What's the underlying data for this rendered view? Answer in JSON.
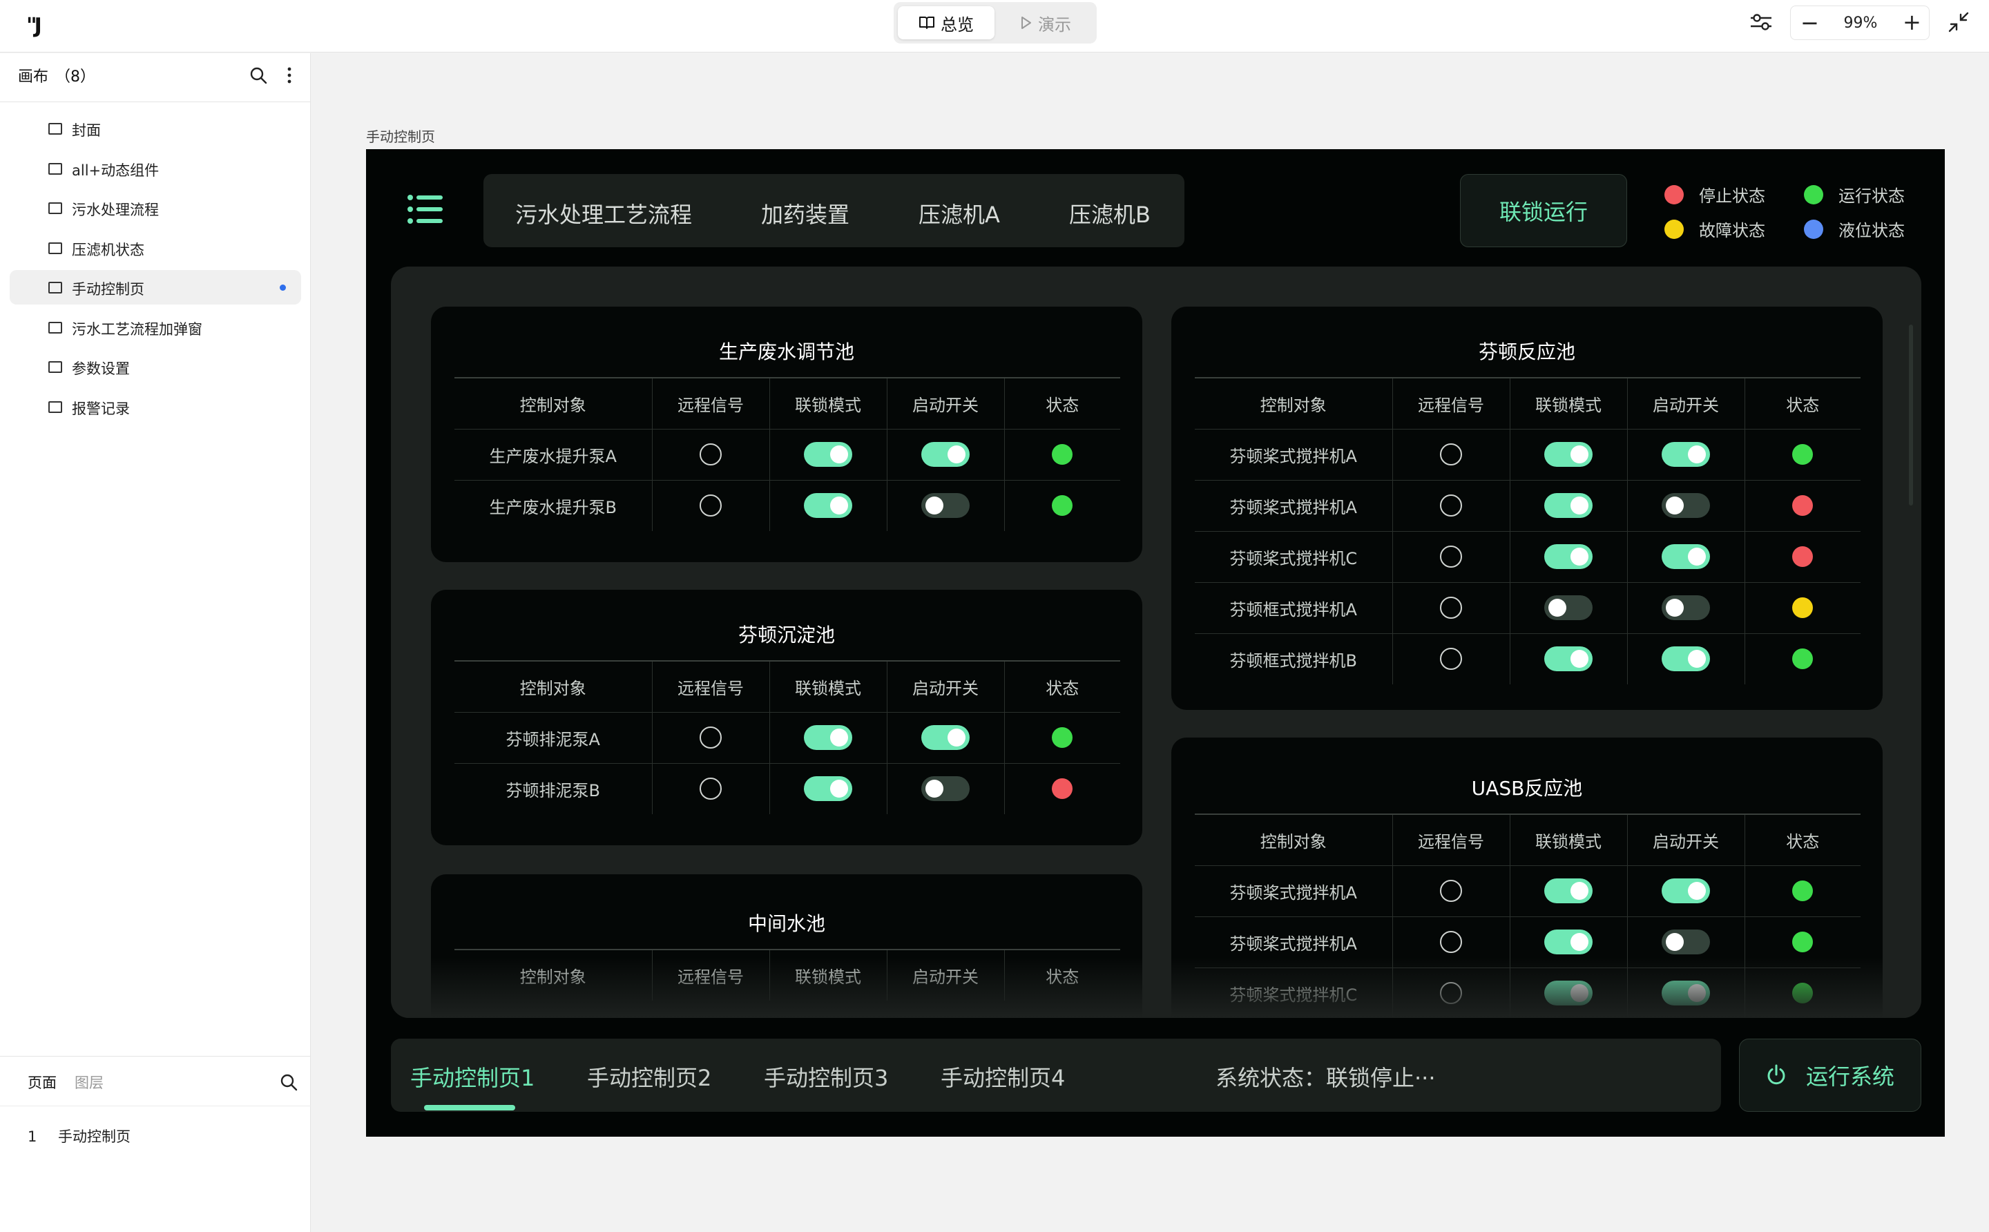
{
  "topbar": {
    "logo": "\"J",
    "mode_overview": "总览",
    "mode_present": "演示",
    "zoom_value": "99%",
    "zoom_minus": "−",
    "zoom_plus": "+"
  },
  "sidebar": {
    "canvas_title": "画布",
    "canvas_count": "（8）",
    "pages": [
      {
        "label": "封面"
      },
      {
        "label": "all+动态组件"
      },
      {
        "label": "污水处理流程"
      },
      {
        "label": "压滤机状态"
      },
      {
        "label": "手动控制页",
        "active": true
      },
      {
        "label": "污水工艺流程加弹窗"
      },
      {
        "label": "参数设置"
      },
      {
        "label": "报警记录"
      }
    ],
    "tab_pages": "页面",
    "tab_layers": "图层",
    "layer_number": "1",
    "layer_name": "手动控制页"
  },
  "frame": {
    "label": "手动控制页",
    "nav_tabs": [
      "污水处理工艺流程",
      "加药装置",
      "压滤机A",
      "压滤机B"
    ],
    "interlock_button": "联锁运行",
    "legend": [
      {
        "label": "停止状态",
        "color": "#f2585d"
      },
      {
        "label": "运行状态",
        "color": "#3ddc4b"
      },
      {
        "label": "故障状态",
        "color": "#f5d312"
      },
      {
        "label": "液位状态",
        "color": "#5b8df5"
      }
    ],
    "colors": {
      "accent": "#6fe8b5",
      "run": "#3ddc4b",
      "stop": "#f2585d",
      "fault": "#f5d312"
    },
    "columns": [
      "控制对象",
      "远程信号",
      "联锁模式",
      "启动开关",
      "状态"
    ],
    "cards": [
      {
        "title": "生产废水调节池",
        "rows": [
          {
            "name": "生产废水提升泵A",
            "interlock": true,
            "start": true,
            "status": "run"
          },
          {
            "name": "生产废水提升泵B",
            "interlock": true,
            "start": false,
            "status": "run"
          }
        ]
      },
      {
        "title": "芬顿沉淀池",
        "rows": [
          {
            "name": "芬顿排泥泵A",
            "interlock": true,
            "start": true,
            "status": "run"
          },
          {
            "name": "芬顿排泥泵B",
            "interlock": true,
            "start": false,
            "status": "stop"
          }
        ]
      },
      {
        "title": "中间水池",
        "rows": []
      },
      {
        "title": "芬顿反应池",
        "rows": [
          {
            "name": "芬顿桨式搅拌机A",
            "interlock": true,
            "start": true,
            "status": "run"
          },
          {
            "name": "芬顿桨式搅拌机A",
            "interlock": true,
            "start": false,
            "status": "stop"
          },
          {
            "name": "芬顿桨式搅拌机C",
            "interlock": true,
            "start": true,
            "status": "stop"
          },
          {
            "name": "芬顿框式搅拌机A",
            "interlock": false,
            "start": false,
            "status": "fault"
          },
          {
            "name": "芬顿框式搅拌机B",
            "interlock": true,
            "start": true,
            "status": "run"
          }
        ]
      },
      {
        "title": "UASB反应池",
        "rows": [
          {
            "name": "芬顿桨式搅拌机A",
            "interlock": true,
            "start": true,
            "status": "run"
          },
          {
            "name": "芬顿桨式搅拌机A",
            "interlock": true,
            "start": false,
            "status": "run"
          },
          {
            "name": "芬顿桨式搅拌机C",
            "interlock": true,
            "start": true,
            "status": "run"
          }
        ]
      }
    ],
    "page_tabs": [
      "手动控制页1",
      "手动控制页2",
      "手动控制页3",
      "手动控制页4"
    ],
    "system_status": "系统状态：联锁停止···",
    "run_button": "运行系统"
  }
}
